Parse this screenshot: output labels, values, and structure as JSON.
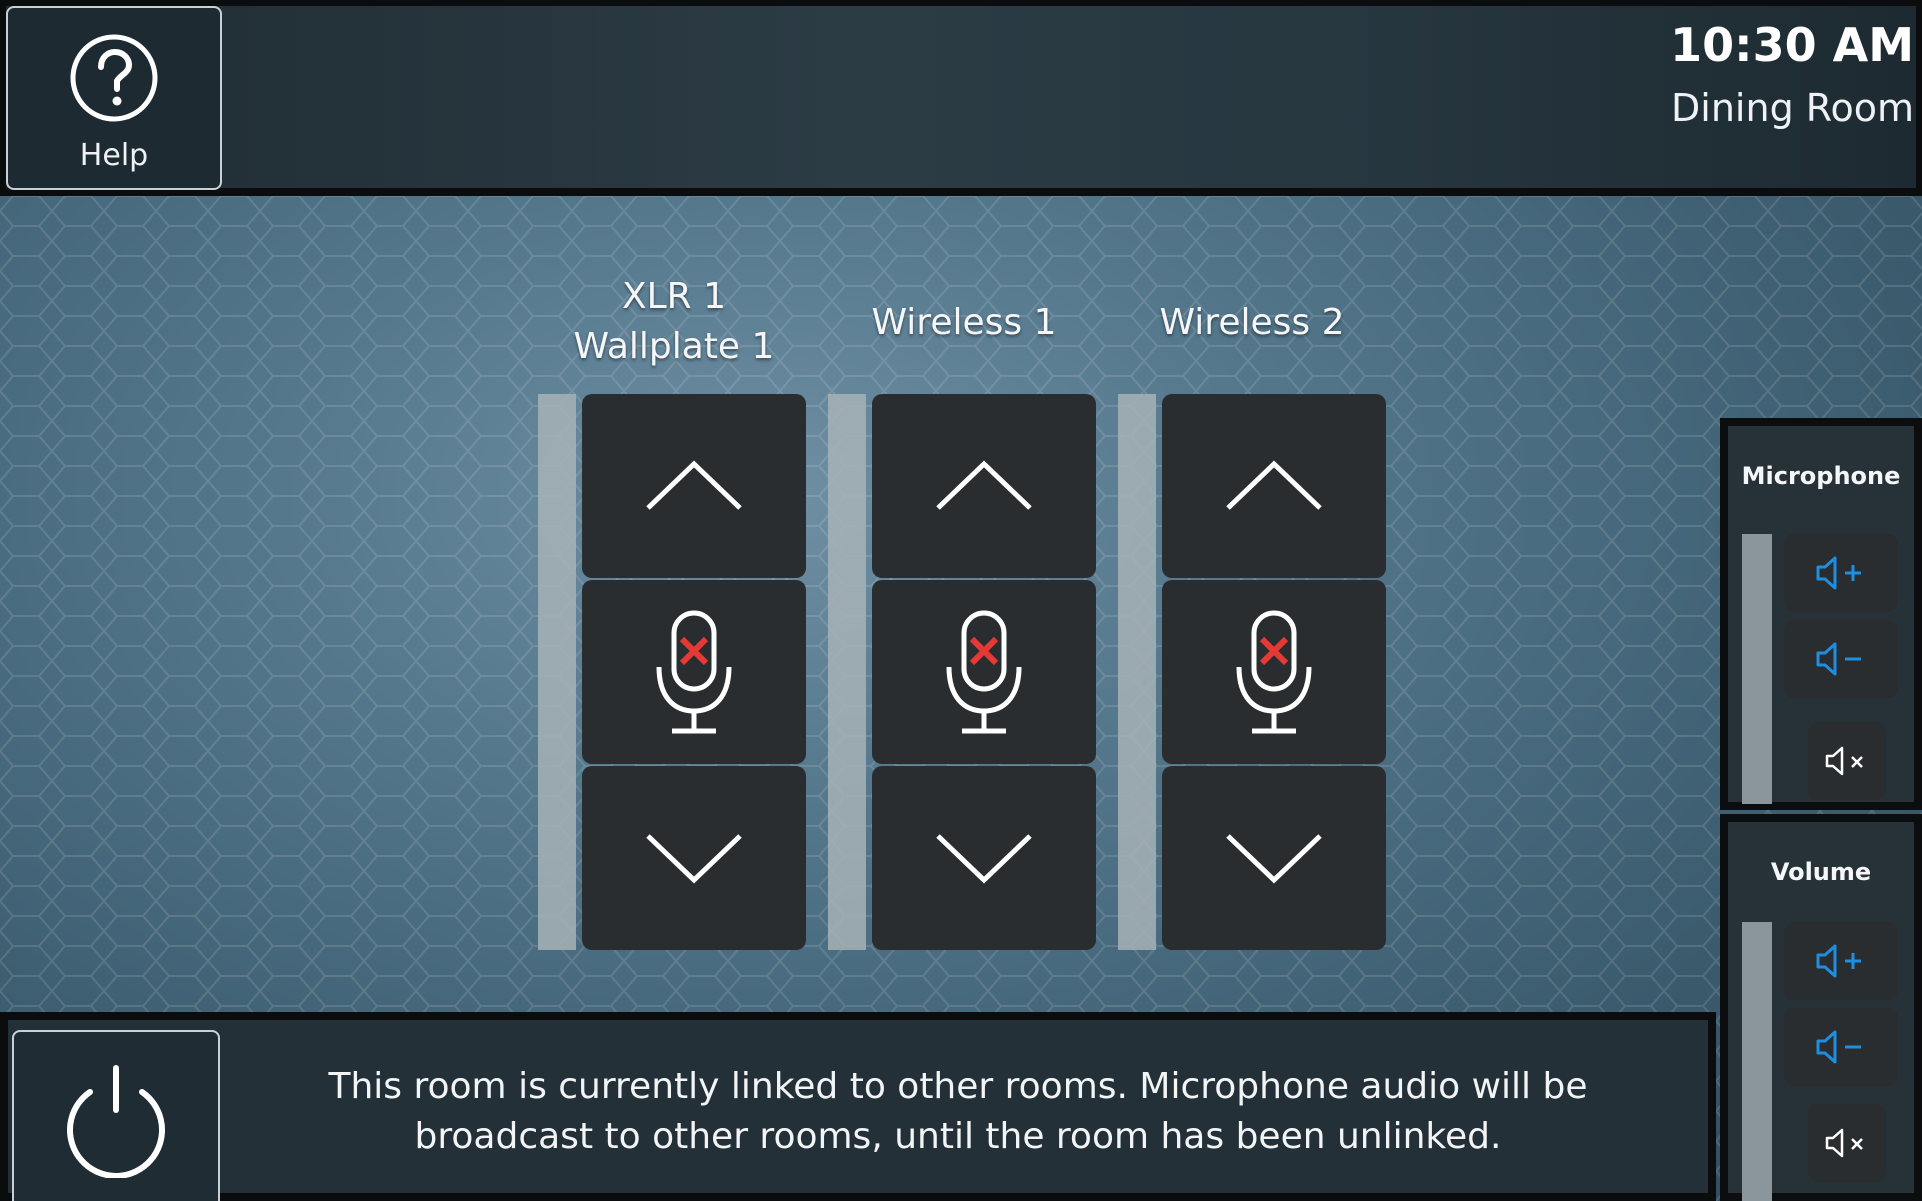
{
  "header": {
    "help_label": "Help",
    "time": "10:30 AM",
    "room_name": "Dining Room"
  },
  "channels": [
    {
      "name": "XLR 1 Wallplate 1",
      "muted": true
    },
    {
      "name": "Wireless 1",
      "muted": true
    },
    {
      "name": "Wireless 2",
      "muted": true
    }
  ],
  "side_panels": {
    "microphone": {
      "title": "Microphone"
    },
    "volume": {
      "title": "Volume"
    }
  },
  "footer": {
    "notice": "This room is currently linked to other rooms. Microphone audio will be broadcast to other rooms, until the room has been unlinked."
  },
  "colors": {
    "accent_blue": "#1e8fe0",
    "mute_red": "#e53935",
    "button_dark": "#2a2d30"
  },
  "icons": {
    "help": "question-circle-icon",
    "power": "power-icon",
    "mic_muted": "microphone-muted-icon",
    "vol_up": "speaker-plus-icon",
    "vol_down": "speaker-minus-icon",
    "mute": "speaker-mute-icon"
  }
}
